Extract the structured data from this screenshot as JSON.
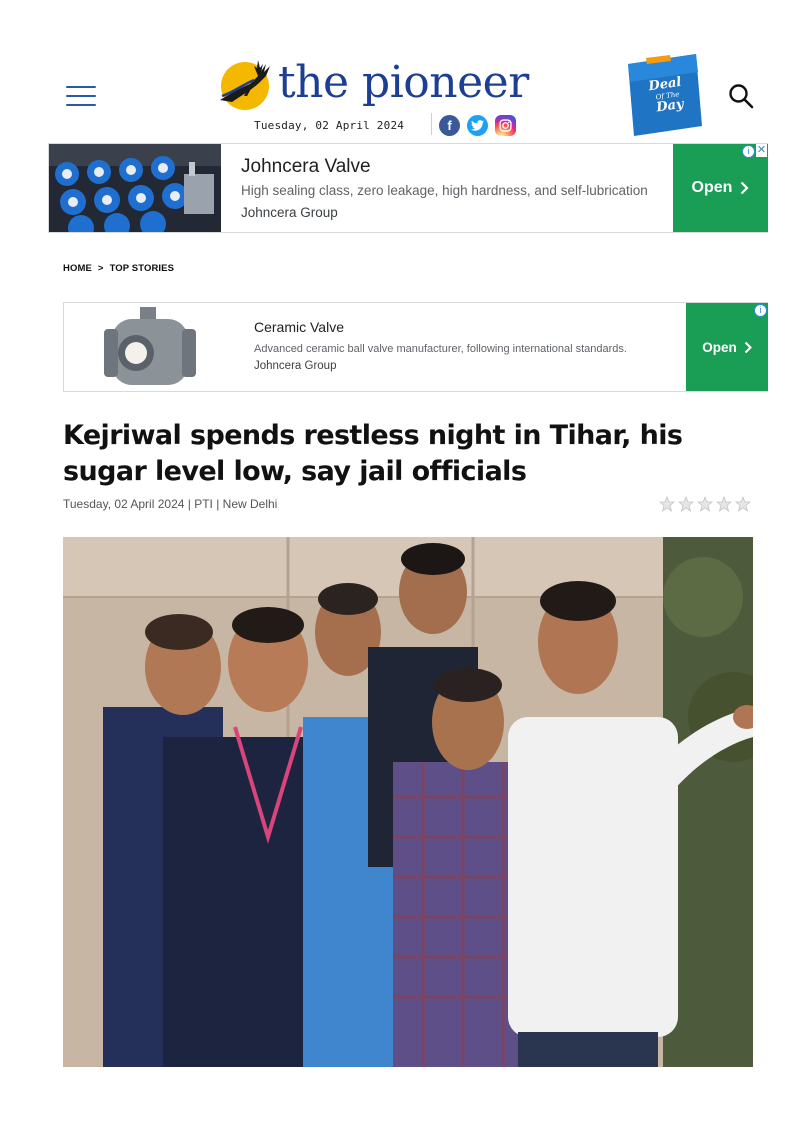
{
  "header": {
    "logo_text": "the pioneer",
    "date": "Tuesday, 02 April 2024",
    "social": {
      "facebook": "f",
      "twitter": "t"
    },
    "deal_badge": {
      "line1": "Deal",
      "line2": "Of The",
      "line3": "Day"
    }
  },
  "ads": [
    {
      "title": "Johncera Valve",
      "description": "High sealing class, zero leakage, high hardness, and self-lubrication",
      "company": "Johncera Group",
      "cta": "Open"
    },
    {
      "title": "Ceramic Valve",
      "description": "Advanced ceramic ball valve manufacturer, following international standards.",
      "company": "Johncera Group",
      "cta": "Open"
    }
  ],
  "breadcrumb": {
    "home": "HOME",
    "separator": ">",
    "current": "TOP STORIES"
  },
  "article": {
    "headline": "Kejriwal spends restless night in Tihar, his sugar level low, say jail officials",
    "meta": "Tuesday, 02 April 2024 | PTI | New Delhi",
    "rating": {
      "stars_total": 5,
      "stars_filled": 0
    }
  },
  "colors": {
    "brand_blue": "#1c3f93",
    "logo_yellow": "#f5b800",
    "ad_green": "#1a9e55",
    "hamburger": "#2a5aa5"
  },
  "icons": [
    "hamburger-icon",
    "deer-logo-icon",
    "facebook-icon",
    "twitter-icon",
    "instagram-icon",
    "search-icon",
    "ad-info-icon",
    "ad-close-icon",
    "chevron-right-icon",
    "star-icon"
  ]
}
